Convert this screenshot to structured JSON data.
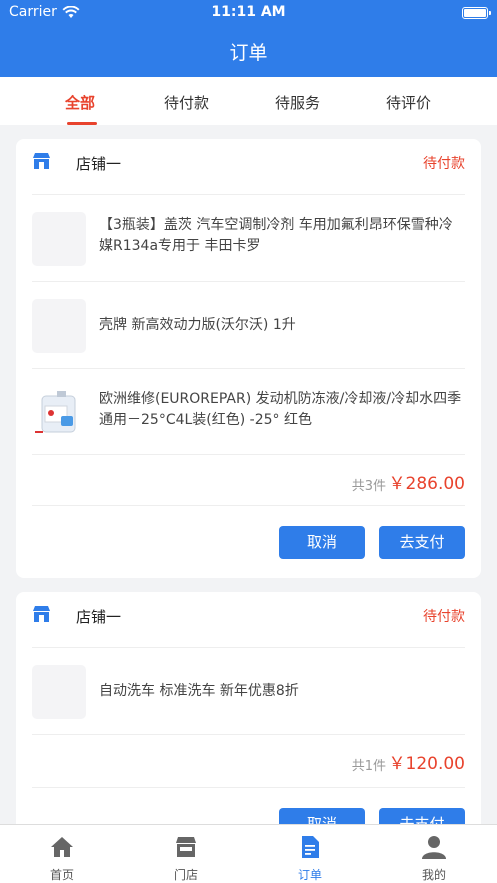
{
  "status_bar": {
    "carrier": "Carrier",
    "time": "11:11 AM"
  },
  "header": {
    "title": "订单"
  },
  "tabs": [
    {
      "label": "全部"
    },
    {
      "label": "待付款"
    },
    {
      "label": "待服务"
    },
    {
      "label": "待评价"
    }
  ],
  "orders": [
    {
      "shop_name": "店铺一",
      "status": "待付款",
      "items": [
        {
          "title": "【3瓶装】盖茨 汽车空调制冷剂 车用加氟利昂环保雪种冷媒R134a专用于 丰田卡罗"
        },
        {
          "title": "壳牌 新高效动力版(沃尔沃) 1升"
        },
        {
          "title": "欧洲维修(EUROREPAR) 发动机防冻液/冷却液/冷却水四季通用－25°C4L装(红色) -25° 红色"
        }
      ],
      "count_label": "共3件",
      "total": "￥286.00",
      "cancel_label": "取消",
      "pay_label": "去支付"
    },
    {
      "shop_name": "店铺一",
      "status": "待付款",
      "items": [
        {
          "title": "自动洗车 标准洗车  新年优惠8折"
        }
      ],
      "count_label": "共1件",
      "total": "￥120.00",
      "cancel_label": "取消",
      "pay_label": "去支付"
    }
  ],
  "tabbar": [
    {
      "label": "首页",
      "icon": "home-icon"
    },
    {
      "label": "门店",
      "icon": "store-icon"
    },
    {
      "label": "订单",
      "icon": "order-icon"
    },
    {
      "label": "我的",
      "icon": "profile-icon"
    }
  ],
  "colors": {
    "primary": "#2f7de9",
    "accent": "#e8432d"
  }
}
